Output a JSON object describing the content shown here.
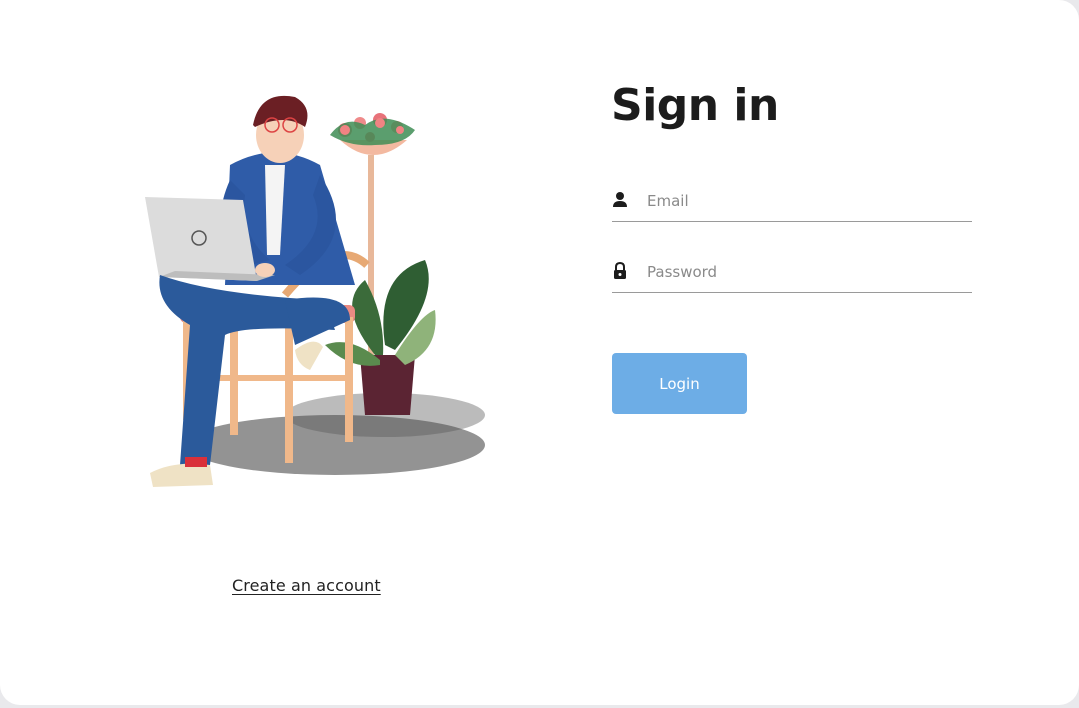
{
  "page": {
    "title": "Sign in"
  },
  "illustration": {
    "subject": "person-with-laptop-on-chair"
  },
  "links": {
    "create_account": "Create an account"
  },
  "form": {
    "email": {
      "placeholder": "Email",
      "value": "",
      "icon": "user-icon"
    },
    "password": {
      "placeholder": "Password",
      "value": "",
      "icon": "lock-icon"
    },
    "login_label": "Login"
  },
  "colors": {
    "accent": "#6dade6",
    "text": "#1c1c1c",
    "underline": "#9a9a9a",
    "background": "#ffffff"
  }
}
